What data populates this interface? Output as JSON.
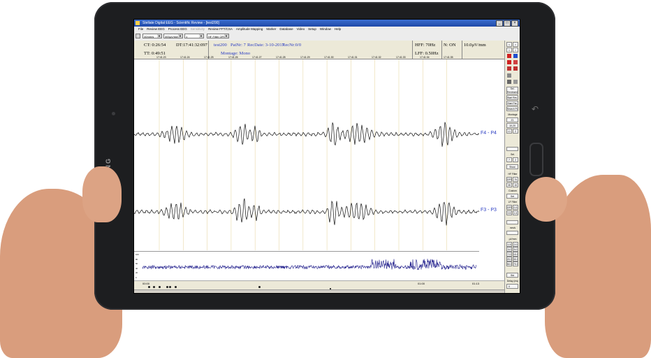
{
  "device": {
    "brand": "SAMSUNG",
    "back_icon": "back-arrow-icon",
    "recent_icon": "recent-apps-icon"
  },
  "window": {
    "title": "Stellate Digital EEG - Scientific Review - [test200]",
    "controls": [
      "_",
      "□",
      "×"
    ]
  },
  "menu": [
    "File",
    "Review EEG",
    "Process EEG",
    "Sensitivity",
    "Review FFT/CSA",
    "Amplitude Mapping",
    "Marker",
    "Database",
    "Video",
    "Setup",
    "Window",
    "Help"
  ],
  "toolbar": {
    "selects": [
      "30mm/s",
      "300µV/mm",
      "1",
      "HF Filter OFF"
    ]
  },
  "info": {
    "ct": "CT: 0:26:54",
    "dt": "DT:17:41:32:097",
    "tt": "TT: 0:49:51",
    "patient": "test200",
    "patnr": "PatNr: 7",
    "recdate": "RecDate: 3-10-2017",
    "recnr": "RecNr:0/0",
    "montage": "Montage: Mono",
    "hff": "HFF: 70Hz",
    "lff": "LFF: 0.50Hz",
    "notch": "N: ON",
    "sensitivity": "10.0µV/mm"
  },
  "time_ticks": [
    "17:41:23",
    "17:41:24",
    "17:41:25",
    "17:41:26",
    "17:41:27",
    "17:41:28",
    "17:41:29",
    "17:41:30",
    "17:41:31",
    "17:41:32",
    "17:41:33",
    "17:41:34",
    "17:41:35"
  ],
  "channels": [
    {
      "name": "F4 - P4"
    },
    {
      "name": "F3 - P3"
    }
  ],
  "overview": {
    "y_labels": [
      "100",
      "80",
      "60",
      "40",
      "20",
      "0"
    ]
  },
  "timebar": {
    "start": "00:00",
    "mid": "01:00",
    "end": "01:13"
  },
  "panel": {
    "nav_arrows": [
      "<",
      ">",
      "<",
      ">"
    ],
    "buttons": [
      "Sel. Reviewed",
      "Start Rev.",
      "Start Pat.",
      "Search Pat."
    ],
    "montage_label": "Montage",
    "montage_vals": [
      "Z1",
      "10-20",
      "L1",
      "2"
    ],
    "sel_label": "Sel.",
    "sel_vals": [
      "7",
      "2"
    ],
    "show_label": "Show",
    "hf_label": "HF Filter",
    "hf_vals": [
      "OFF",
      "70",
      "35",
      "15"
    ],
    "custom_label": "Custom",
    "set_label": "Set",
    "lf_label": "LF Filter",
    "lf_vals": [
      "OFF",
      "0.3",
      "0.5",
      "1.6"
    ],
    "mms_label": "mm/s",
    "uvmm_label": "µV/mm",
    "uvmm_vals": [
      "1.5",
      "2.0",
      "3.0",
      "5.0",
      "7.0",
      "10.0",
      "20.0",
      "30.0",
      "50.0",
      "70.0"
    ],
    "std_label": "Std",
    "delay_label": "Delay (ms)",
    "delay_val": "0"
  }
}
